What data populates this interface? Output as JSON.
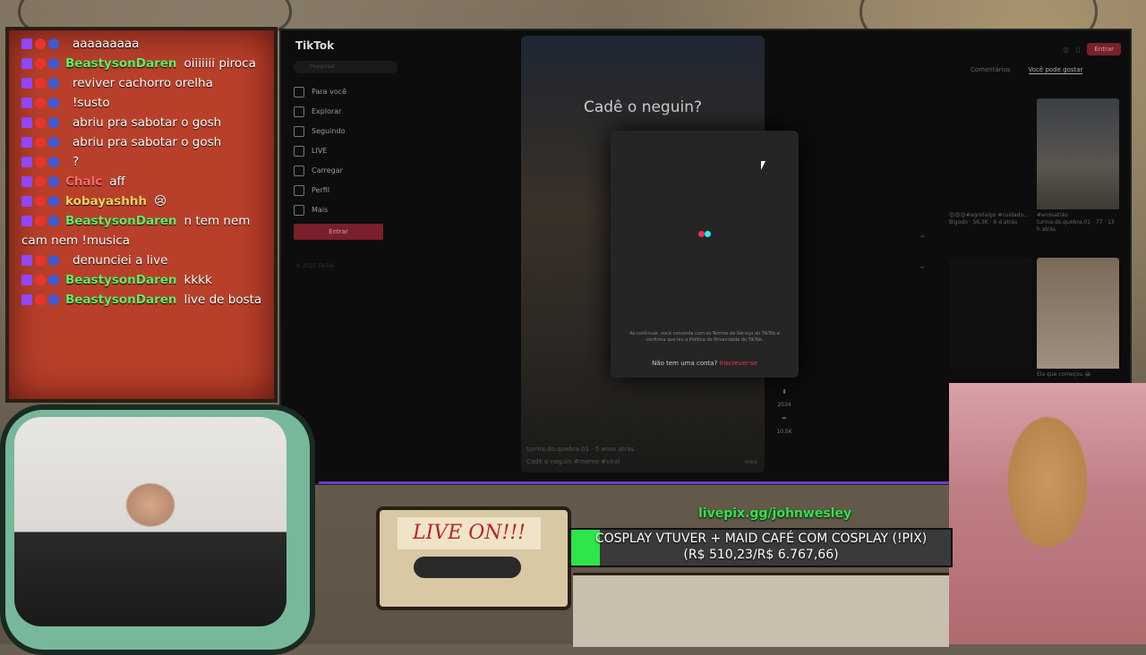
{
  "chat": {
    "messages": [
      {
        "user": "",
        "text": "aaaaaaaaa",
        "user_color": "#ff3b30"
      },
      {
        "user": "BeastysonDaren",
        "text": "oiiiiiii piroca",
        "user_color": "#5cf06a"
      },
      {
        "user": "",
        "text": "reviver cachorro orelha",
        "user_color": "#ff3b30"
      },
      {
        "user": "",
        "text": "!susto",
        "user_color": "#9146ff"
      },
      {
        "user": "",
        "text": "abriu pra sabotar o gosh",
        "user_color": "#8a4bff"
      },
      {
        "user": "",
        "text": "abriu pra sabotar o gosh",
        "user_color": "#8a4bff"
      },
      {
        "user": "",
        "text": "?",
        "user_color": "#ff3b30"
      },
      {
        "user": "Chalc",
        "text": "aff",
        "user_color": "#ff6b6b"
      },
      {
        "user": "kobayashhh",
        "text": "😢",
        "user_color": "#f0d25c"
      },
      {
        "user": "BeastysonDaren",
        "text": "n tem nem cam nem !musica",
        "user_color": "#5cf06a"
      },
      {
        "user": "",
        "text": "denunciei a live",
        "user_color": "#ff3b30"
      },
      {
        "user": "BeastysonDaren",
        "text": "kkkk",
        "user_color": "#5cf06a"
      },
      {
        "user": "BeastysonDaren",
        "text": "live de bosta",
        "user_color": "#5cf06a"
      }
    ]
  },
  "tiktok": {
    "logo": "TikTok",
    "search_placeholder": "Pesquisar",
    "nav": [
      "Para você",
      "Explorar",
      "Seguindo",
      "LIVE",
      "Carregar",
      "Perfil",
      "Mais"
    ],
    "login_button": "Entrar",
    "copyright": "© 2025 TikTok",
    "top_enter": "Entrar",
    "tabs": [
      "Comentários",
      "Você pode gostar"
    ],
    "video_title": "Cadê o neguin?",
    "video_caption1": "turma.do.quebra.01 · 5 anos atrás",
    "video_caption2": "Cadê o neguin #meme #viral",
    "video_more": "mais",
    "actions": [
      "2034",
      "10,5K"
    ],
    "modal_terms": "Ao continuar, você concorda com os Termos de Serviço do TikTok e confirma que leu a Política de Privacidade do TikTok.",
    "modal_signup_text": "Não tem uma conta?",
    "modal_signup_link": "Inscrever-se",
    "thumbs": [
      {
        "cap": "😍😍😍#agrotaigo #cuidado... Bigodo · 56,3K · 6 d atrás"
      },
      {
        "cap": "#anosatrás turma.do.quebra.01 · 77 · 13 h atrás"
      },
      {
        "cap": ""
      },
      {
        "cap": "Ela que começou 😂"
      }
    ]
  },
  "overlay": {
    "cassette_label": "LIVE ON!!!",
    "goal_url": "livepix.gg/johnwesley",
    "goal_title": "COSPLAY VTUVER + MAID CAFÉ COM COSPLAY (!PIX)",
    "goal_amount": "(R$ 510,23/R$ 6.767,66)",
    "goal_progress": 0.075
  }
}
